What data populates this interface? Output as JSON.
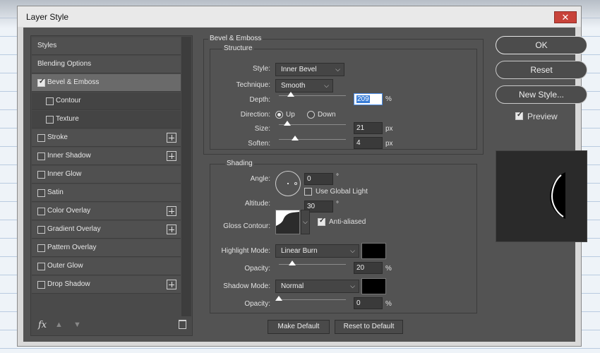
{
  "window": {
    "title": "Layer Style",
    "close_glyph": "✕"
  },
  "left": {
    "items": [
      {
        "label": "Styles",
        "checkbox": false,
        "checked": false,
        "plus": false,
        "indent": 0
      },
      {
        "label": "Blending Options",
        "checkbox": false,
        "checked": false,
        "plus": false,
        "indent": 0
      },
      {
        "label": "Bevel & Emboss",
        "checkbox": true,
        "checked": true,
        "plus": false,
        "indent": 0,
        "selected": true
      },
      {
        "label": "Contour",
        "checkbox": true,
        "checked": false,
        "plus": false,
        "indent": 1
      },
      {
        "label": "Texture",
        "checkbox": true,
        "checked": false,
        "plus": false,
        "indent": 1
      },
      {
        "label": "Stroke",
        "checkbox": true,
        "checked": false,
        "plus": true,
        "indent": 0
      },
      {
        "label": "Inner Shadow",
        "checkbox": true,
        "checked": false,
        "plus": true,
        "indent": 0
      },
      {
        "label": "Inner Glow",
        "checkbox": true,
        "checked": false,
        "plus": false,
        "indent": 0
      },
      {
        "label": "Satin",
        "checkbox": true,
        "checked": false,
        "plus": false,
        "indent": 0
      },
      {
        "label": "Color Overlay",
        "checkbox": true,
        "checked": false,
        "plus": true,
        "indent": 0
      },
      {
        "label": "Gradient Overlay",
        "checkbox": true,
        "checked": false,
        "plus": true,
        "indent": 0
      },
      {
        "label": "Pattern Overlay",
        "checkbox": true,
        "checked": false,
        "plus": false,
        "indent": 0
      },
      {
        "label": "Outer Glow",
        "checkbox": true,
        "checked": false,
        "plus": false,
        "indent": 0
      },
      {
        "label": "Drop Shadow",
        "checkbox": true,
        "checked": false,
        "plus": true,
        "indent": 0
      }
    ],
    "fx_label": "fx"
  },
  "bevel": {
    "heading": "Bevel & Emboss",
    "structure": "Structure",
    "style_label": "Style:",
    "style_value": "Inner Bevel",
    "technique_label": "Technique:",
    "technique_value": "Smooth",
    "depth_label": "Depth:",
    "depth_value": "209",
    "depth_unit": "%",
    "direction_label": "Direction:",
    "dir_up": "Up",
    "dir_down": "Down",
    "size_label": "Size:",
    "size_value": "21",
    "size_unit": "px",
    "soften_label": "Soften:",
    "soften_value": "4",
    "soften_unit": "px",
    "depth_level": 0.18,
    "size_level": 0.13,
    "soften_level": 0.24
  },
  "shading": {
    "heading": "Shading",
    "angle_label": "Angle:",
    "angle_value": "0",
    "angle_unit": "°",
    "altitude_label": "Altitude:",
    "altitude_value": "30",
    "altitude_unit": "°",
    "global_light": "Use Global Light",
    "gloss_label": "Gloss Contour:",
    "anti_aliased": "Anti-aliased",
    "highlight_mode_label": "Highlight Mode:",
    "highlight_mode_value": "Linear Burn",
    "highlight_opacity_label": "Opacity:",
    "highlight_opacity_value": "20",
    "highlight_opacity_unit": "%",
    "shadow_mode_label": "Shadow Mode:",
    "shadow_mode_value": "Normal",
    "shadow_opacity_label": "Opacity:",
    "shadow_opacity_value": "0",
    "shadow_opacity_unit": "%",
    "highlight_color": "#000000",
    "shadow_color": "#000000",
    "highlight_opacity_level": 0.2,
    "shadow_opacity_level": 0.0
  },
  "buttons": {
    "make_default": "Make Default",
    "reset_default": "Reset to Default",
    "ok": "OK",
    "reset": "Reset",
    "new_style": "New Style...",
    "preview": "Preview"
  }
}
